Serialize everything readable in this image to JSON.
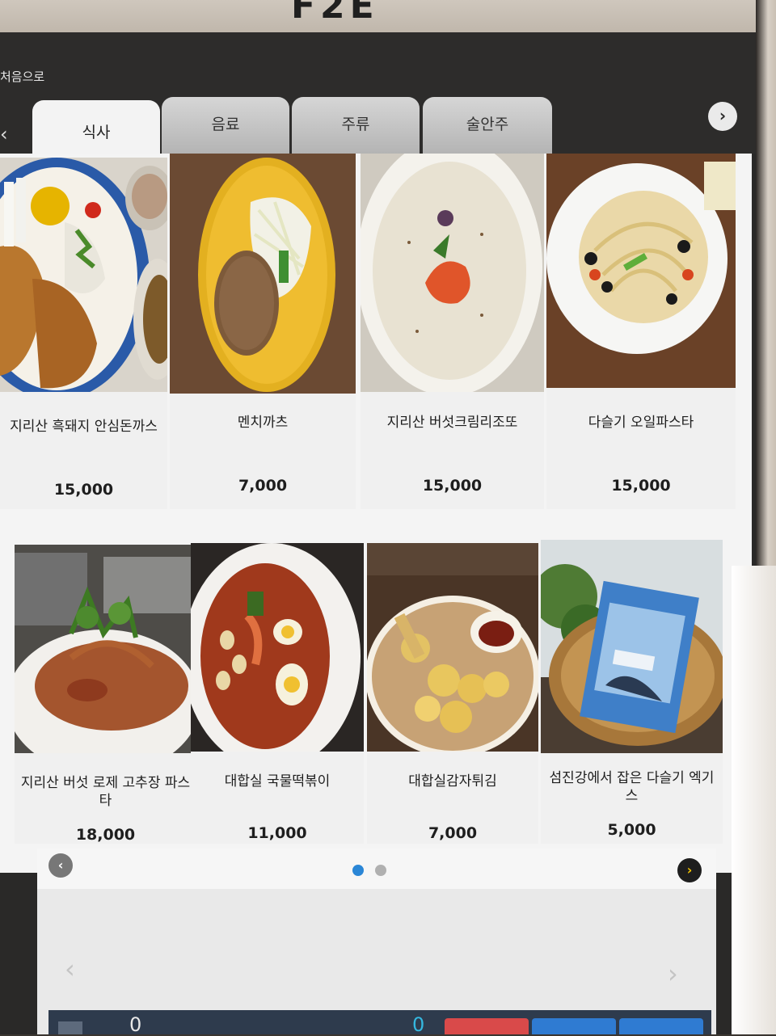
{
  "header": {
    "home_label": "처음으로",
    "tabs": [
      "식사",
      "음료",
      "주류",
      "술안주"
    ]
  },
  "menu": [
    {
      "name": "지리산 흑돼지 안심돈까스",
      "price": "15,000"
    },
    {
      "name": "멘치까츠",
      "price": "7,000"
    },
    {
      "name": "지리산 버섯크림리조또",
      "price": "15,000"
    },
    {
      "name": "다슬기 오일파스타",
      "price": "15,000"
    },
    {
      "name": "지리산 버섯 로제 고추장 파스타",
      "price": "18,000"
    },
    {
      "name": "대합실 국물떡볶이",
      "price": "11,000"
    },
    {
      "name": "대합실감자튀김",
      "price": "7,000"
    },
    {
      "name": "섬진강에서 잡은 다슬기 엑기스",
      "price": "5,000"
    }
  ],
  "footer": {
    "cart_count": "0",
    "pay_count": "0"
  },
  "colors": {
    "active_dot": "#2a86d6",
    "inactive_dot": "#b0b0b0",
    "next_arrow": "#f2c300"
  }
}
